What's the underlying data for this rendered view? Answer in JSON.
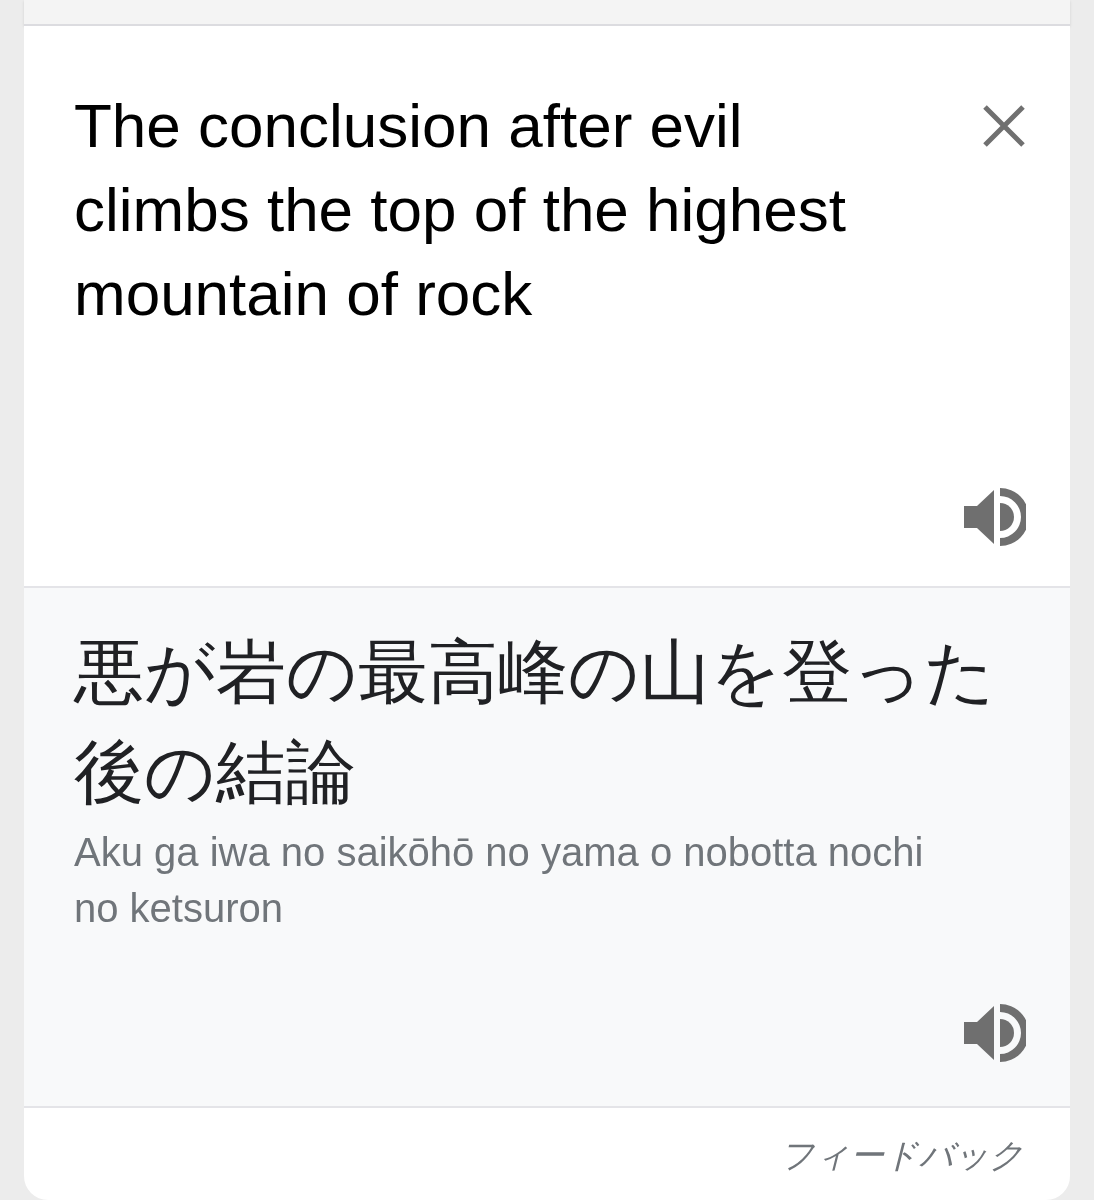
{
  "source": {
    "text": "The conclusion after evil climbs the top of the highest mountain of rock"
  },
  "translation": {
    "text": "悪が岩の最高峰の山を登った後の結論",
    "romanization": "Aku ga iwa no saikōhō no yama o nobotta nochi no ketsuron"
  },
  "footer": {
    "feedback": "フィードバック"
  }
}
